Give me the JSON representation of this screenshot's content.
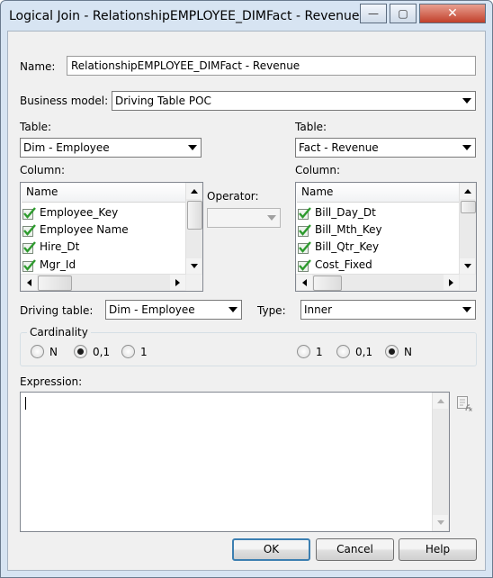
{
  "window": {
    "title": "Logical Join - RelationshipEMPLOYEE_DIMFact - Revenue",
    "minimize_glyph": "—",
    "maximize_glyph": "▢",
    "close_glyph": "✕"
  },
  "name": {
    "label": "Name:",
    "value": "RelationshipEMPLOYEE_DIMFact - Revenue"
  },
  "business_model": {
    "label": "Business model:",
    "value": "Driving Table POC"
  },
  "left_table": {
    "label": "Table:",
    "value": "Dim - Employee",
    "column_label": "Column:",
    "column_header": "Name",
    "columns": [
      "Employee_Key",
      "Employee Name",
      "Hire_Dt",
      "Mgr_Id"
    ]
  },
  "operator": {
    "label": "Operator:",
    "value": ""
  },
  "right_table": {
    "label": "Table:",
    "value": "Fact - Revenue",
    "column_label": "Column:",
    "column_header": "Name",
    "columns": [
      "Bill_Day_Dt",
      "Bill_Mth_Key",
      "Bill_Qtr_Key",
      "Cost_Fixed"
    ]
  },
  "driving_table": {
    "label": "Driving table:",
    "value": "Dim - Employee"
  },
  "type": {
    "label": "Type:",
    "value": "Inner"
  },
  "cardinality": {
    "label": "Cardinality",
    "left_options": [
      "N",
      "0,1",
      "1"
    ],
    "left_selected": "0,1",
    "right_options": [
      "1",
      "0,1",
      "N"
    ],
    "right_selected": "N"
  },
  "expression": {
    "label": "Expression:",
    "value": ""
  },
  "buttons": {
    "ok": "OK",
    "cancel": "Cancel",
    "help": "Help"
  },
  "colors": {
    "frame": "#d7e4f2",
    "client": "#f0f0f0",
    "check_green": "#2e9b2e",
    "default_button_border": "#3c7fb1"
  },
  "icons": [
    "check-icon",
    "expression-builder-icon",
    "chevron-down-icon"
  ]
}
